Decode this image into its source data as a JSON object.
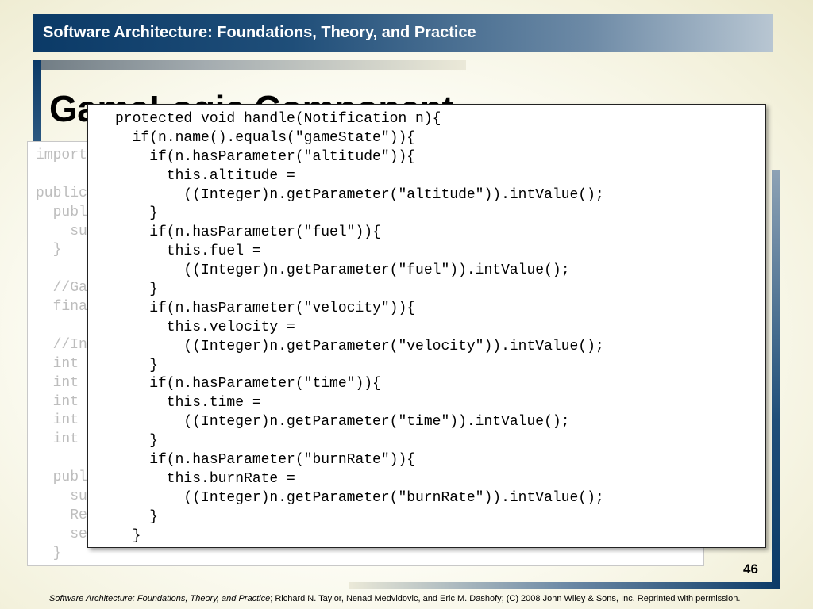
{
  "header": {
    "title": "Software Architecture: Foundations, Theory, and Practice"
  },
  "slide": {
    "title": "GameLogic Component",
    "number": "46"
  },
  "background_code": {
    "lines": [
      "import",
      "",
      "public",
      "  publ",
      "    su",
      "  }",
      "",
      "  //Ga",
      "  fina",
      "",
      "  //In",
      "  int",
      "  int",
      "  int",
      "  int",
      "  int",
      "",
      "  publ",
      "    su",
      "    Re",
      "    se",
      "  }"
    ]
  },
  "foreground_code": {
    "lines": [
      "protected void handle(Notification n){",
      "  if(n.name().equals(\"gameState\")){",
      "    if(n.hasParameter(\"altitude\")){",
      "      this.altitude =",
      "        ((Integer)n.getParameter(\"altitude\")).intValue();",
      "    }",
      "    if(n.hasParameter(\"fuel\")){",
      "      this.fuel =",
      "        ((Integer)n.getParameter(\"fuel\")).intValue();",
      "    }",
      "    if(n.hasParameter(\"velocity\")){",
      "      this.velocity =",
      "        ((Integer)n.getParameter(\"velocity\")).intValue();",
      "    }",
      "    if(n.hasParameter(\"time\")){",
      "      this.time =",
      "        ((Integer)n.getParameter(\"time\")).intValue();",
      "    }",
      "    if(n.hasParameter(\"burnRate\")){",
      "      this.burnRate =",
      "        ((Integer)n.getParameter(\"burnRate\")).intValue();",
      "    }",
      "  }"
    ]
  },
  "footer": {
    "book_title": "Software Architecture: Foundations, Theory, and Practice",
    "credit": "; Richard N. Taylor, Nenad Medvidovic, and Eric M. Dashofy; (C) 2008 John Wiley & Sons, Inc. Reprinted with permission."
  },
  "colors": {
    "header_dark": "#0b3a67",
    "header_light": "#b8c6d2",
    "faded_code": "#bdbdbd"
  }
}
